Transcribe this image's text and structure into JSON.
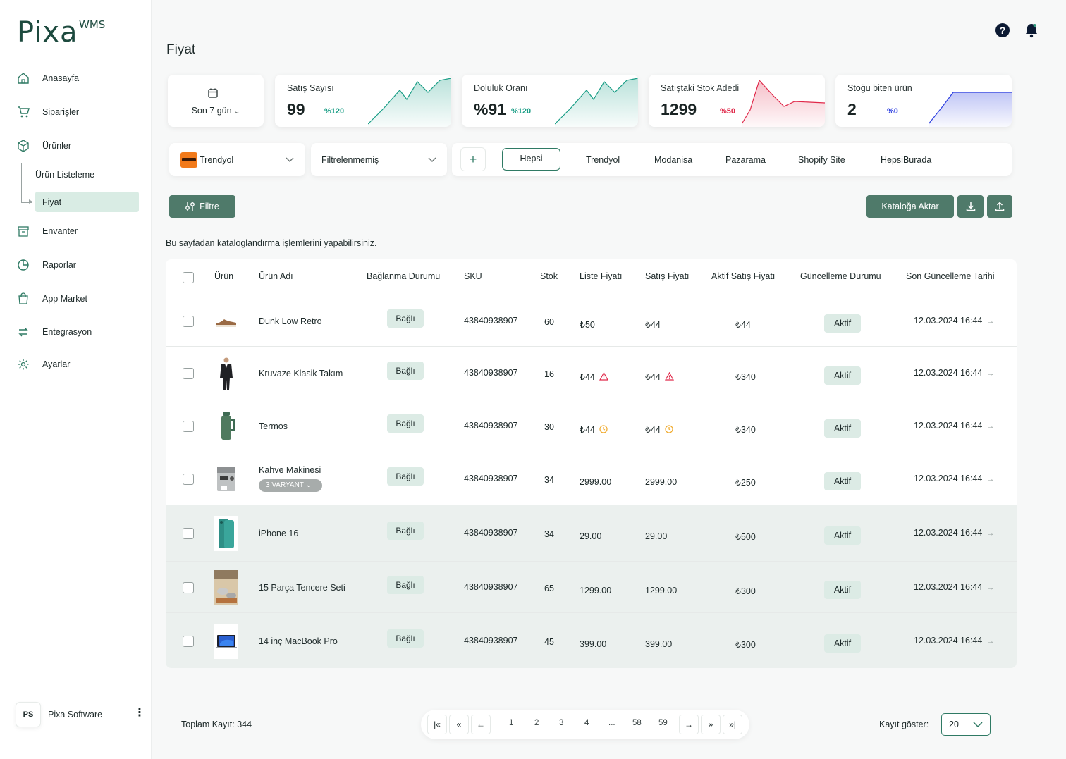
{
  "brand": {
    "logo": "Pixa",
    "sup": "WMS"
  },
  "nav": [
    {
      "label": "Anasayfa",
      "icon": "home-icon"
    },
    {
      "label": "Siparişler",
      "icon": "cart-icon"
    },
    {
      "label": "Ürünler",
      "icon": "box-icon"
    },
    {
      "label": "Envanter",
      "icon": "archive-icon"
    },
    {
      "label": "Raporlar",
      "icon": "pie-chart-icon"
    },
    {
      "label": "App Market",
      "icon": "shopping-bag-icon"
    },
    {
      "label": "Entegrasyon",
      "icon": "sync-icon"
    },
    {
      "label": "Ayarlar",
      "icon": "gear-icon"
    }
  ],
  "subnav": [
    {
      "label": "Ürün Listeleme"
    },
    {
      "label": "Fiyat"
    }
  ],
  "user": {
    "initials": "PS",
    "name": "Pixa Software"
  },
  "page": {
    "title": "Fiyat",
    "info": "Bu sayfadan kataloglandırma işlemlerini yapabilirsiniz."
  },
  "date_filter": {
    "label": "Son 7 gün"
  },
  "stats": [
    {
      "title": "Satış Sayısı",
      "value": "99",
      "pct": "%120",
      "color": "#1a9e86"
    },
    {
      "title": "Doluluk Oranı",
      "value": "%91",
      "pct": "%120",
      "color": "#1a9e86"
    },
    {
      "title": "Satıştaki Stok Adedi",
      "value": "1299",
      "pct": "%50",
      "color": "#e0294a"
    },
    {
      "title": "Stoğu biten ürün",
      "value": "2",
      "pct": "%0",
      "color": "#2d3fe0"
    }
  ],
  "filters": {
    "marketplace": "Trendyol",
    "status": "Filtrelenmemiş"
  },
  "tabs": {
    "plus": "+",
    "active": "Hepsi",
    "items": [
      "Trendyol",
      "Modanisa",
      "Pazarama",
      "Shopify Site",
      "HepsiBurada"
    ]
  },
  "buttons": {
    "filter": "Filtre",
    "catalog": "Kataloğa Aktar"
  },
  "table": {
    "headers": [
      "Ürün",
      "Ürün Adı",
      "Bağlanma Durumu",
      "SKU",
      "Stok",
      "Liste Fiyatı",
      "Satış Fiyatı",
      "Aktif Satış Fiyatı",
      "Güncelleme Durumu",
      "Son Güncelleme Tarihi"
    ],
    "rows": [
      {
        "name": "Dunk Low Retro",
        "bind": "Bağlı",
        "sku": "43840938907",
        "stock": "60",
        "list": "₺50",
        "sale": "₺44",
        "active": "₺44",
        "status": "Aktif",
        "date": "12.03.2024 16:44",
        "thumb": "shoe"
      },
      {
        "name": "Kruvaze Klasik Takım",
        "bind": "Bağlı",
        "sku": "43840938907",
        "stock": "16",
        "list": "₺44",
        "sale": "₺44",
        "active": "₺340",
        "status": "Aktif",
        "date": "12.03.2024 16:44",
        "thumb": "suit",
        "warn": "warning"
      },
      {
        "name": "Termos",
        "bind": "Bağlı",
        "sku": "43840938907",
        "stock": "30",
        "list": "₺44",
        "sale": "₺44",
        "active": "₺340",
        "status": "Aktif",
        "date": "12.03.2024 16:44",
        "thumb": "thermos",
        "warn": "clock"
      },
      {
        "name": "Kahve Makinesi",
        "variant": "3 VARYANT",
        "bind": "Bağlı",
        "sku": "43840938907",
        "stock": "34",
        "list": "2999.00",
        "sale": "2999.00",
        "active": "₺250",
        "status": "Aktif",
        "date": "12.03.2024 16:44",
        "thumb": "coffee"
      },
      {
        "name": "iPhone 16",
        "bind": "Bağlı",
        "sku": "43840938907",
        "stock": "34",
        "list": "29.00",
        "sale": "29.00",
        "active": "₺500",
        "status": "Aktif",
        "date": "12.03.2024 16:44",
        "thumb": "phone"
      },
      {
        "name": "15 Parça Tencere Seti",
        "bind": "Bağlı",
        "sku": "43840938907",
        "stock": "65",
        "list": "1299.00",
        "sale": "1299.00",
        "active": "₺300",
        "status": "Aktif",
        "date": "12.03.2024 16:44",
        "thumb": "pots"
      },
      {
        "name": "14 inç MacBook Pro",
        "bind": "Bağlı",
        "sku": "43840938907",
        "stock": "45",
        "list": "399.00",
        "sale": "399.00",
        "active": "₺300",
        "status": "Aktif",
        "date": "12.03.2024 16:44",
        "thumb": "laptop"
      }
    ]
  },
  "footer": {
    "total": "Toplam Kayıt: 344",
    "pages": [
      "1",
      "2",
      "3",
      "4",
      "...",
      "58",
      "59"
    ],
    "per_label": "Kayıt göster:",
    "per_value": "20"
  }
}
